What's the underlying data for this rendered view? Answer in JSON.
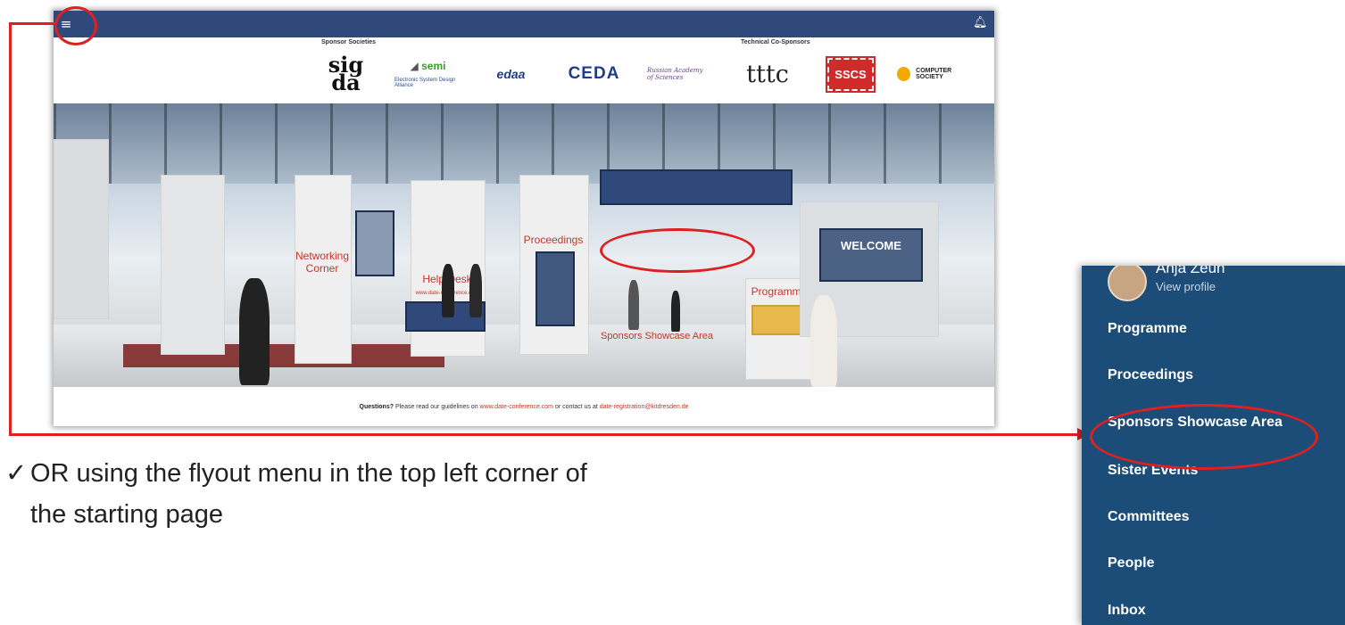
{
  "header": {
    "menu_icon": "hamburger-icon",
    "bell_icon": "bell-icon"
  },
  "sponsors": {
    "societies_label": "Sponsor Societies",
    "cosponsors_label": "Technical Co-Sponsors",
    "logos": {
      "sigda": "sig da",
      "semi": "semi",
      "esd": "Electronic System Design Alliance",
      "edaa": "edaa",
      "ceda": "CEDA",
      "bas": "Russian Academy of Sciences",
      "tttc": "tttc",
      "sscs": "SSCS",
      "computer": "COMPUTER SOCIETY"
    }
  },
  "hall": {
    "networking": "Networking Corner",
    "helpdesk": "Help Desk",
    "helpdesk_url": "www.date-conference.com",
    "proceedings": "Proceedings",
    "sponsors_area": "Sponsors Showcase Area",
    "programme": "Programme",
    "welcome": "WELCOME"
  },
  "footer": {
    "questions": "Questions?",
    "text1": " Please read our guidelines on ",
    "link1": "www.date-conference.com",
    "text2": " or contact us at ",
    "link2": "date-registration@kitdresden.de"
  },
  "caption": {
    "check": "✓",
    "line1": "OR using the flyout menu in the top left corner of",
    "line2": "the starting page"
  },
  "flyout": {
    "user_name": "Anja Zeun",
    "view_profile": "View profile",
    "items": [
      "Programme",
      "Proceedings",
      "Sponsors Showcase Area",
      "Sister Events",
      "Committees",
      "People",
      "Inbox"
    ]
  },
  "colors": {
    "accent": "#e02020",
    "topbar": "#2f4a7a",
    "flyout_bg": "#1c4c78"
  }
}
